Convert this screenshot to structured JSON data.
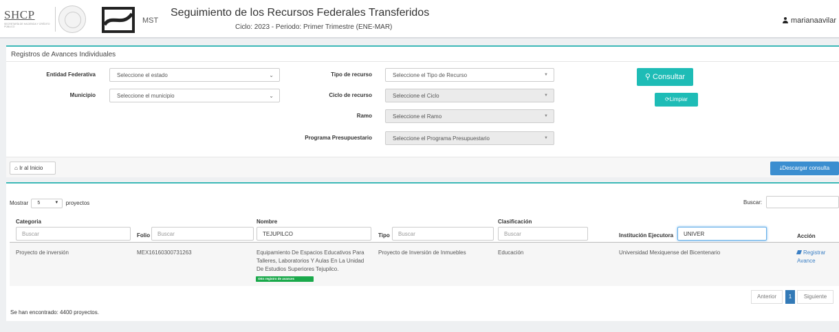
{
  "header": {
    "shcp_logo_text": "SHCP",
    "shcp_logo_subtext": "SECRETARÍA DE HACIENDA Y CRÉDITO PÚBLICO",
    "mst_label": "MST",
    "title": "Seguimiento de los Recursos Federales Transferidos",
    "cycle_period": "Ciclo: 2023 - Periodo: Primer Trimestre (ENE-MAR)",
    "username": "marianaavilar"
  },
  "filters": {
    "panel_title": "Registros de Avances Individuales",
    "entidad_label": "Entidad Federativa",
    "entidad_value": "Seleccione el estado",
    "municipio_label": "Municipio",
    "municipio_value": "Seleccione el municipio",
    "tipo_label": "Tipo de recurso",
    "tipo_value": "Seleccione el Tipo de Recurso",
    "ciclo_label": "Ciclo de recurso",
    "ciclo_value": "Seleccione el Ciclo",
    "ramo_label": "Ramo",
    "ramo_value": "Seleccione el Ramo",
    "programa_label": "Programa Presupuestario",
    "programa_value": "Seleccione el Programa Presupuestario",
    "consultar_label": "Consultar",
    "limpiar_label": "Limpiar",
    "inicio_label": "Ir al Inicio",
    "descargar_label": "Descargar consulta"
  },
  "table_controls": {
    "mostrar_label": "Mostrar",
    "page_size": "5",
    "proyectos_label": "proyectos",
    "buscar_label": "Buscar:"
  },
  "columns": {
    "categoria": {
      "label": "Categoria",
      "placeholder": "Buscar",
      "value": ""
    },
    "folio": {
      "label": "Folio",
      "placeholder": "Buscar",
      "value": ""
    },
    "nombre": {
      "label": "Nombre",
      "placeholder": "Buscar",
      "value": "TEJUPILCO"
    },
    "tipo": {
      "label": "Tipo",
      "placeholder": "Buscar",
      "value": ""
    },
    "clasificacion": {
      "label": "Clasificación",
      "placeholder": "Buscar",
      "value": ""
    },
    "institucion": {
      "label": "Institución Ejecutora",
      "placeholder": "Buscar",
      "value": "UNIVER"
    },
    "accion": {
      "label": "Acción"
    }
  },
  "rows": [
    {
      "categoria": "Proyecto de inversión",
      "folio": "MEX16160300731263",
      "nombre_line1": "Equipamiento De Espacios Educativos Para",
      "nombre_line2": "Talleres, Laboratorios Y Aulas En La Unidad",
      "nombre_line3": "De Estudios Superiores Tejupilco.",
      "status_badge": "En registro de avances",
      "tipo": "Proyecto de Inversión de Inmuebles",
      "clasificacion": "Educación",
      "institucion": "Universidad Mexiquense del Bicentenario",
      "accion_line1": "Registrar",
      "accion_line2": "Avance"
    }
  ],
  "pagination": {
    "previous": "Anterior",
    "current": "1",
    "next": "Siguiente"
  },
  "results_text": "Se han encontrado: 4400 proyectos.",
  "colors": {
    "accent": "#1ebcb6",
    "primary_blue": "#3b8ed0",
    "status_green": "#1aa94b"
  }
}
